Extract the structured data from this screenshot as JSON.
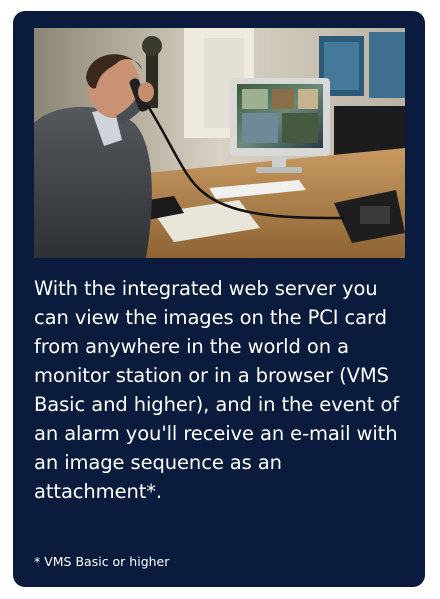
{
  "photo": {
    "description_icon": "photo-man-on-phone-at-monitor"
  },
  "caption": {
    "text": "With the integrated web server you can view the images on the PCI card from anywhere in the world on a monitor station or in a browser (VMS Basic and higher), and in the event of an alarm you'll receive an e-mail with an image sequence as an attachment*."
  },
  "footnote": {
    "text": "* VMS Basic or higher"
  },
  "colors": {
    "card_background": "#0b1b3d",
    "text": "#ffffff"
  }
}
